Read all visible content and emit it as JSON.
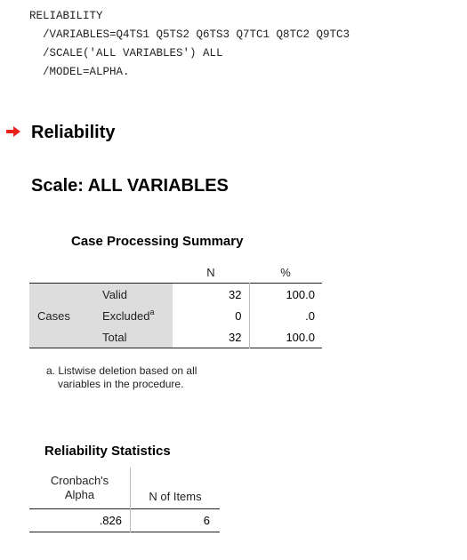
{
  "syntax": {
    "lines": [
      "RELIABILITY",
      "  /VARIABLES=Q4TS1 Q5TS2 Q6TS3 Q7TC1 Q8TC2 Q9TC3",
      "  /SCALE('ALL VARIABLES') ALL",
      "  /MODEL=ALPHA."
    ]
  },
  "section_title": "Reliability",
  "scale_title": "Scale: ALL VARIABLES",
  "case_processing": {
    "title": "Case Processing Summary",
    "col_headers": [
      "N",
      "%"
    ],
    "group_label": "Cases",
    "rows": [
      {
        "label": "Valid",
        "superscript": "",
        "n": "32",
        "pct": "100.0"
      },
      {
        "label": "Excluded",
        "superscript": "a",
        "n": "0",
        "pct": ".0"
      },
      {
        "label": "Total",
        "superscript": "",
        "n": "32",
        "pct": "100.0"
      }
    ],
    "footnote_line1": "a. Listwise deletion based on all",
    "footnote_line2": "variables in the procedure."
  },
  "reliability_stats": {
    "title": "Reliability Statistics",
    "col1_header_line1": "Cronbach's",
    "col1_header_line2": "Alpha",
    "col2_header": "N of Items",
    "alpha": ".826",
    "n_items": "6"
  },
  "colors": {
    "arrow": "#e8231b",
    "row_header_bg": "#dddddd"
  }
}
